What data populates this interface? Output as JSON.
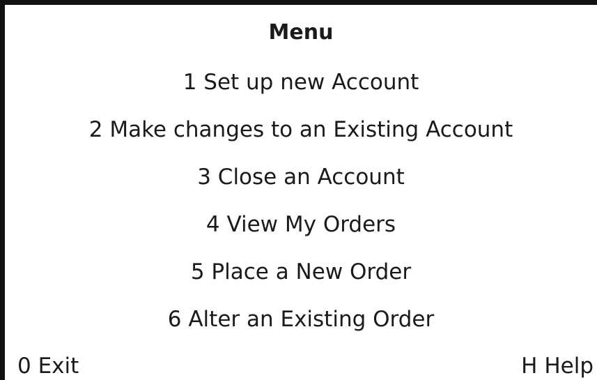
{
  "menu": {
    "title": "Menu",
    "items": [
      {
        "label": "1 Set up new Account"
      },
      {
        "label": "2 Make changes to an Existing Account"
      },
      {
        "label": "3 Close an Account"
      },
      {
        "label": "4 View My Orders"
      },
      {
        "label": "5 Place a New Order"
      },
      {
        "label": "6 Alter an Existing Order"
      }
    ]
  },
  "footer": {
    "exit_label": "0 Exit",
    "help_label": "H Help"
  },
  "colors": {
    "background": "#ffffff",
    "text": "#1a1a1a",
    "border": "#111111"
  }
}
